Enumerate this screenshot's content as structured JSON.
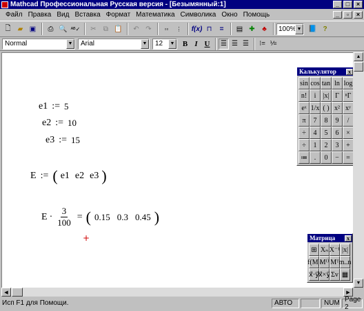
{
  "window": {
    "title": "Mathcad Профессиональная Русская версия - [Безымянный:1]"
  },
  "menu": [
    "Файл",
    "Правка",
    "Вид",
    "Вставка",
    "Формат",
    "Математика",
    "Символика",
    "Окно",
    "Помощь"
  ],
  "toolbar": {
    "zoom": "100%"
  },
  "format": {
    "style": "Normal",
    "font": "Arial",
    "size": "12",
    "bold": "B",
    "italic": "I",
    "underline": "U"
  },
  "worksheet": {
    "e1": {
      "name": "e1",
      "op": ":=",
      "value": "5"
    },
    "e2": {
      "name": "e2",
      "op": ":=",
      "value": "10"
    },
    "e3": {
      "name": "e3",
      "op": ":=",
      "value": "15"
    },
    "vector_def": {
      "name": "E",
      "op": ":=",
      "items": [
        "e1",
        "e2",
        "e3"
      ]
    },
    "result": {
      "name": "E",
      "dot": "·",
      "num": "3",
      "den": "100",
      "eq": "=",
      "values": [
        "0.15",
        "0.3",
        "0.45"
      ]
    },
    "cursor": "+"
  },
  "calculator": {
    "title": "Калькулятор",
    "close": "x",
    "rows": [
      [
        "sin",
        "cos",
        "tan",
        "ln",
        "log"
      ],
      [
        "n!",
        "i",
        "|x|",
        "Γ",
        "ⁿΓ"
      ],
      [
        "eˣ",
        "1/x",
        "( )",
        "x²",
        "xʸ"
      ],
      [
        "π",
        "7",
        "8",
        "9",
        "/"
      ],
      [
        "÷",
        "4",
        "5",
        "6",
        "×"
      ],
      [
        "÷",
        "1",
        "2",
        "3",
        "+"
      ],
      [
        "≔",
        ".",
        "0",
        "−",
        "="
      ]
    ]
  },
  "matrix": {
    "title": "Матрица",
    "close": "x",
    "rows": [
      [
        "⊞",
        "Xₙ",
        "X⁻¹",
        "|x|"
      ],
      [
        "f(M)",
        "M⁽⁾",
        "Mᵀ",
        "m..n"
      ],
      [
        "x⃗·y⃗",
        "x⃗×y⃗",
        "Σv",
        "▦"
      ]
    ]
  },
  "status": {
    "help": "Исп F1 для Помощи.",
    "mode": "АВТО",
    "num": "NUM",
    "page": "Page 2"
  }
}
